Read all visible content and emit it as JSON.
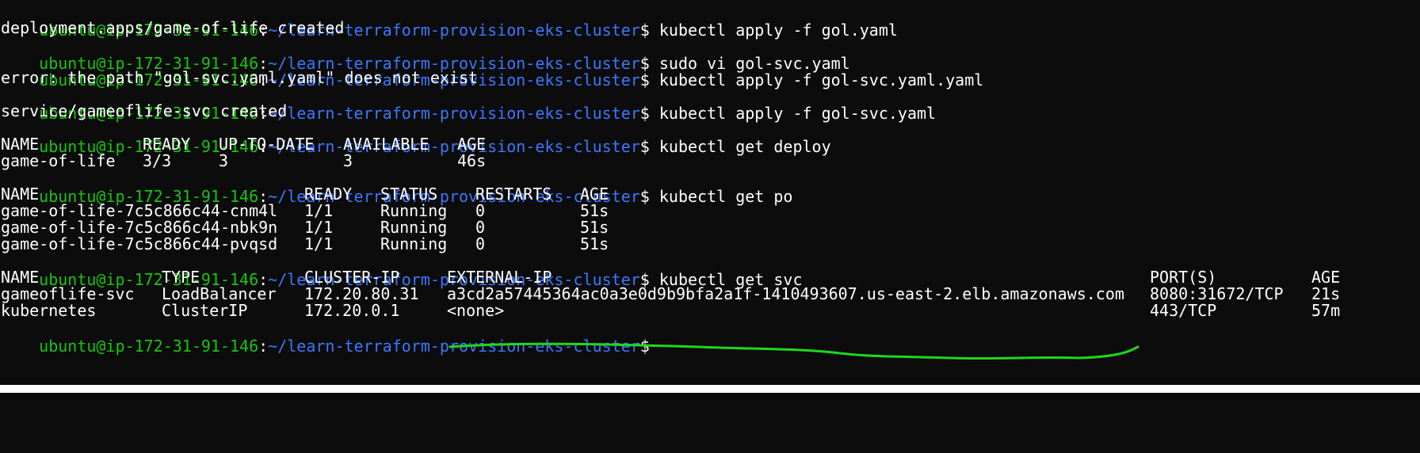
{
  "terminal": {
    "prompt": {
      "user_host": "ubuntu@ip-172-31-91-146",
      "colon": ":",
      "path": "~/learn-terraform-provision-eks-cluster",
      "symbol": "$"
    },
    "cmd_1": "kubectl apply -f gol.yaml",
    "out_1": "deployment.apps/game-of-life created",
    "cmd_2": "sudo vi gol-svc.yaml",
    "cmd_3": "kubectl apply -f gol-svc.yaml.yaml",
    "out_3": "error: the path \"gol-svc.yaml.yaml\" does not exist",
    "cmd_4": "kubectl apply -f gol-svc.yaml",
    "out_4": "service/gameoflife-svc created",
    "cmd_5": "kubectl get deploy",
    "deploy_table": {
      "headers": [
        "NAME",
        "READY",
        "UP-TO-DATE",
        "AVAILABLE",
        "AGE"
      ],
      "rows": [
        [
          "game-of-life",
          "3/3",
          "3",
          "3",
          "46s"
        ]
      ]
    },
    "cmd_6": "kubectl get po",
    "po_table": {
      "headers": [
        "NAME",
        "READY",
        "STATUS",
        "RESTARTS",
        "AGE"
      ],
      "rows": [
        [
          "game-of-life-7c5c866c44-cnm4l",
          "1/1",
          "Running",
          "0",
          "51s"
        ],
        [
          "game-of-life-7c5c866c44-nbk9n",
          "1/1",
          "Running",
          "0",
          "51s"
        ],
        [
          "game-of-life-7c5c866c44-pvqsd",
          "1/1",
          "Running",
          "0",
          "51s"
        ]
      ]
    },
    "cmd_7": "kubectl get svc",
    "svc_table": {
      "headers": [
        "NAME",
        "TYPE",
        "CLUSTER-IP",
        "EXTERNAL-IP",
        "PORT(S)",
        "AGE"
      ],
      "rows": [
        [
          "gameoflife-svc",
          "LoadBalancer",
          "172.20.80.31",
          "a3cd2a57445364ac0a3e0d9b9bfa2a1f-1410493607.us-east-2.elb.amazonaws.com",
          "8080:31672/TCP",
          "21s"
        ],
        [
          "kubernetes",
          "ClusterIP",
          "172.20.0.1",
          "<none>",
          "443/TCP",
          "57m"
        ]
      ]
    }
  },
  "colors": {
    "background": "#0c0c0c",
    "user_host": "#16c60c",
    "path": "#3b78ff",
    "text": "#ffffff",
    "annotation": "#1fd81f"
  }
}
